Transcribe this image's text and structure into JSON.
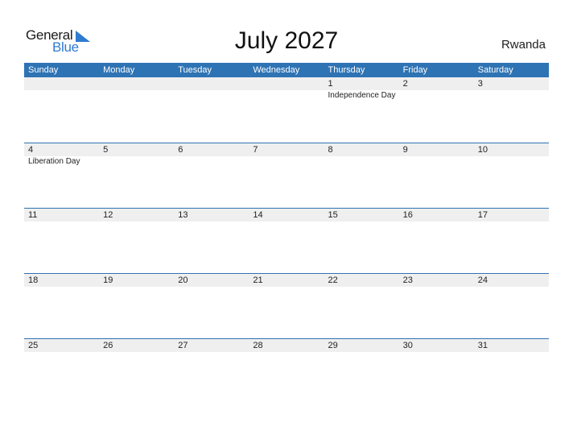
{
  "logo": {
    "general": "General",
    "blue": "Blue",
    "brand_color": "#2e7bd1"
  },
  "title": "July 2027",
  "country": "Rwanda",
  "header_color": "#2e73b4",
  "weekdays": [
    "Sunday",
    "Monday",
    "Tuesday",
    "Wednesday",
    "Thursday",
    "Friday",
    "Saturday"
  ],
  "weeks": [
    {
      "days": [
        "",
        "",
        "",
        "",
        "1",
        "2",
        "3"
      ],
      "events": [
        "",
        "",
        "",
        "",
        "Independence Day",
        "",
        ""
      ]
    },
    {
      "days": [
        "4",
        "5",
        "6",
        "7",
        "8",
        "9",
        "10"
      ],
      "events": [
        "Liberation Day",
        "",
        "",
        "",
        "",
        "",
        ""
      ]
    },
    {
      "days": [
        "11",
        "12",
        "13",
        "14",
        "15",
        "16",
        "17"
      ],
      "events": [
        "",
        "",
        "",
        "",
        "",
        "",
        ""
      ]
    },
    {
      "days": [
        "18",
        "19",
        "20",
        "21",
        "22",
        "23",
        "24"
      ],
      "events": [
        "",
        "",
        "",
        "",
        "",
        "",
        ""
      ]
    },
    {
      "days": [
        "25",
        "26",
        "27",
        "28",
        "29",
        "30",
        "31"
      ],
      "events": [
        "",
        "",
        "",
        "",
        "",
        "",
        ""
      ]
    }
  ]
}
